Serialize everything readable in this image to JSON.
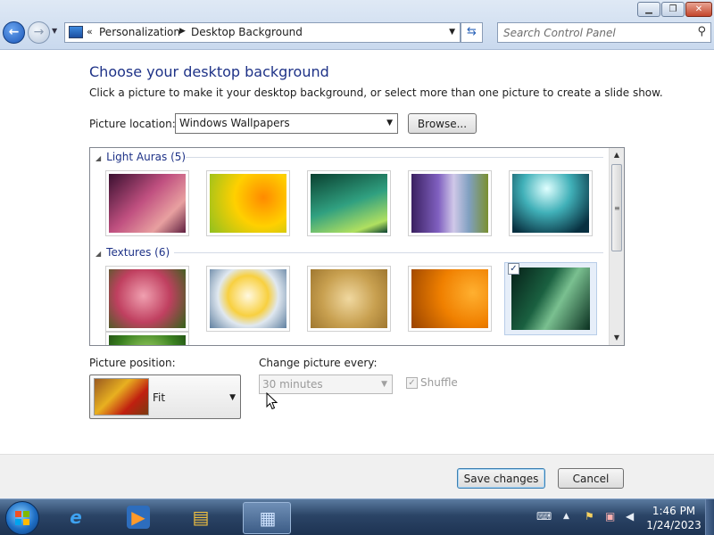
{
  "window": {
    "min_glyph": "▁",
    "max_glyph": "❐",
    "close_glyph": "✕"
  },
  "address_bar": {
    "back_glyph": "←",
    "forward_glyph": "→",
    "history_glyph": "▼",
    "overflow": "«",
    "breadcrumbs": [
      "Personalization",
      "Desktop Background"
    ],
    "separator_glyph": "▶",
    "dropdown_glyph": "▼",
    "refresh_glyph": "⇆"
  },
  "search": {
    "placeholder": "Search Control Panel",
    "icon_glyph": "⚲"
  },
  "page": {
    "title": "Choose your desktop background",
    "description": "Click a picture to make it your desktop background, or select more than one picture to create a slide show."
  },
  "picture_location": {
    "label": "Picture location:",
    "value": "Windows Wallpapers",
    "dropdown_glyph": "▼",
    "browse_label": "Browse..."
  },
  "gallery": {
    "collapse_glyph": "◢",
    "groups": [
      {
        "name": "Light Auras (5)",
        "thumbs": [
          {
            "gradient": "linear-gradient(135deg,#3a1030,#c05080 45%,#e8a0a0 75%,#602040)",
            "selected": false
          },
          {
            "gradient": "radial-gradient(circle at 70% 40%,#ff8a00,#ffd000 45%,#90c020)",
            "selected": false
          },
          {
            "gradient": "linear-gradient(160deg,#0a4030,#30a080 50%,#b0e060 85%,#0a4030)",
            "selected": false
          },
          {
            "gradient": "linear-gradient(90deg,#3a2060,#8060c0 35%,#d0c8e8 55%,#80a0c0 75%,#7a9030)",
            "selected": false
          },
          {
            "gradient": "radial-gradient(circle at 45% 25%,#e0ffff,#40b0b8 40%,#083040 85%)",
            "selected": false
          }
        ]
      },
      {
        "name": "Textures (6)",
        "thumbs": [
          {
            "gradient": "radial-gradient(circle at 45% 45%,#f0a0b0,#c04060 50%,#406020 95%)",
            "selected": false
          },
          {
            "gradient": "radial-gradient(circle at 50% 45%,#fff8e0,#f8d040 40%,#e0e8f0 60%,#6080a0)",
            "selected": false
          },
          {
            "gradient": "radial-gradient(circle at 50% 50%,#f0d8a0,#c8a050 55%,#a07830)",
            "selected": false
          },
          {
            "gradient": "radial-gradient(circle at 80% 40%,#ffb030,#f08000 45%,#a04800 95%)",
            "selected": false
          },
          {
            "gradient": "linear-gradient(120deg,#062018,#1a6040 40%,#7ac090 60%,#0a3020)",
            "selected": true
          },
          {
            "gradient": "radial-gradient(circle at 50% 40%,#b0e070,#3a8020 60%,#1a4010)",
            "selected": false
          }
        ]
      }
    ],
    "check_glyph": "✓",
    "scroll_up_glyph": "▲",
    "scroll_down_glyph": "▼",
    "scroll_grip_glyph": "≡"
  },
  "picture_position": {
    "label": "Picture position:",
    "value": "Fit",
    "dropdown_glyph": "▼"
  },
  "change_picture": {
    "label": "Change picture every:",
    "value": "30 minutes",
    "dropdown_glyph": "▼",
    "shuffle_label": "Shuffle",
    "check_glyph": "✓"
  },
  "footer": {
    "save_label": "Save changes",
    "cancel_label": "Cancel"
  },
  "taskbar": {
    "items": [
      {
        "name": "internet-explorer",
        "glyph": "e",
        "active": false
      },
      {
        "name": "media-player",
        "glyph": "▶",
        "active": false
      },
      {
        "name": "file-explorer",
        "glyph": "▤",
        "active": false
      },
      {
        "name": "control-panel",
        "glyph": "▦",
        "active": true
      }
    ],
    "tray": {
      "keyboard_glyph": "⌨",
      "show_hidden_glyph": "▲",
      "action_center_glyph": "⚑",
      "network_glyph": "▣",
      "volume_glyph": "◀"
    },
    "clock_time": "1:46 PM",
    "clock_date": "1/24/2023"
  },
  "colors": {
    "title_blue": "#1e3287",
    "taskbar": "#2b4466",
    "accent": "#3c7fb1"
  }
}
